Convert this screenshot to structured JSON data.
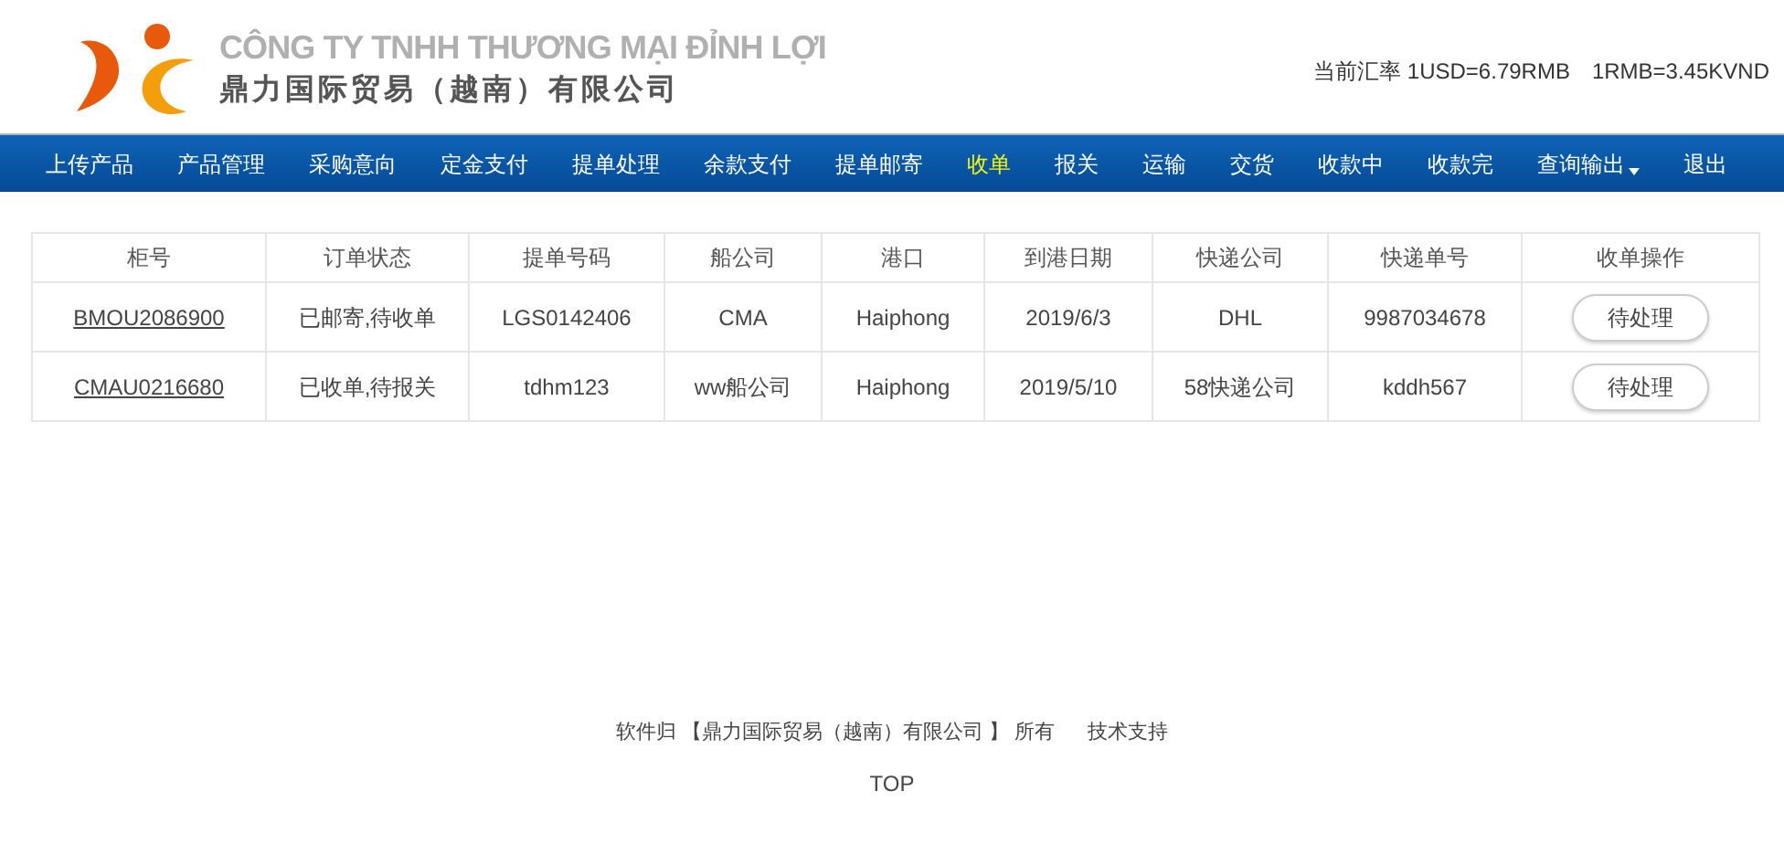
{
  "header": {
    "company_vn": "CÔNG TY TNHH THƯƠNG MẠI ĐỈNH LỢI",
    "company_cn": "鼎力国际贸易（越南）有限公司",
    "rate": "当前汇率 1USD=6.79RMB　1RMB=3.45KVND"
  },
  "nav": [
    {
      "label": "上传产品",
      "selected": false,
      "dropdown": false
    },
    {
      "label": "产品管理",
      "selected": false,
      "dropdown": false
    },
    {
      "label": "采购意向",
      "selected": false,
      "dropdown": false
    },
    {
      "label": "定金支付",
      "selected": false,
      "dropdown": false
    },
    {
      "label": "提单处理",
      "selected": false,
      "dropdown": false
    },
    {
      "label": "余款支付",
      "selected": false,
      "dropdown": false
    },
    {
      "label": "提单邮寄",
      "selected": false,
      "dropdown": false
    },
    {
      "label": "收单",
      "selected": true,
      "dropdown": false
    },
    {
      "label": "报关",
      "selected": false,
      "dropdown": false
    },
    {
      "label": "运输",
      "selected": false,
      "dropdown": false
    },
    {
      "label": "交货",
      "selected": false,
      "dropdown": false
    },
    {
      "label": "收款中",
      "selected": false,
      "dropdown": false
    },
    {
      "label": "收款完",
      "selected": false,
      "dropdown": false
    },
    {
      "label": "查询输出",
      "selected": false,
      "dropdown": true
    },
    {
      "label": "退出",
      "selected": false,
      "dropdown": false
    }
  ],
  "table": {
    "columns": [
      "柜号",
      "订单状态",
      "提单号码",
      "船公司",
      "港口",
      "到港日期",
      "快递公司",
      "快递单号",
      "收单操作"
    ],
    "rows": [
      {
        "cells": [
          "BMOU2086900",
          "已邮寄,待收单",
          "LGS0142406",
          "CMA",
          "Haiphong",
          "2019/6/3",
          "DHL",
          "9987034678"
        ],
        "action": "待处理"
      },
      {
        "cells": [
          "CMAU0216680",
          "已收单,待报关",
          "tdhm123",
          "ww船公司",
          "Haiphong",
          "2019/5/10",
          "58快递公司",
          "kddh567"
        ],
        "action": "待处理"
      }
    ]
  },
  "footer": {
    "owner": "软件归 【鼎力国际贸易（越南）有限公司 】 所有",
    "support": "技术支持",
    "top": "TOP"
  }
}
